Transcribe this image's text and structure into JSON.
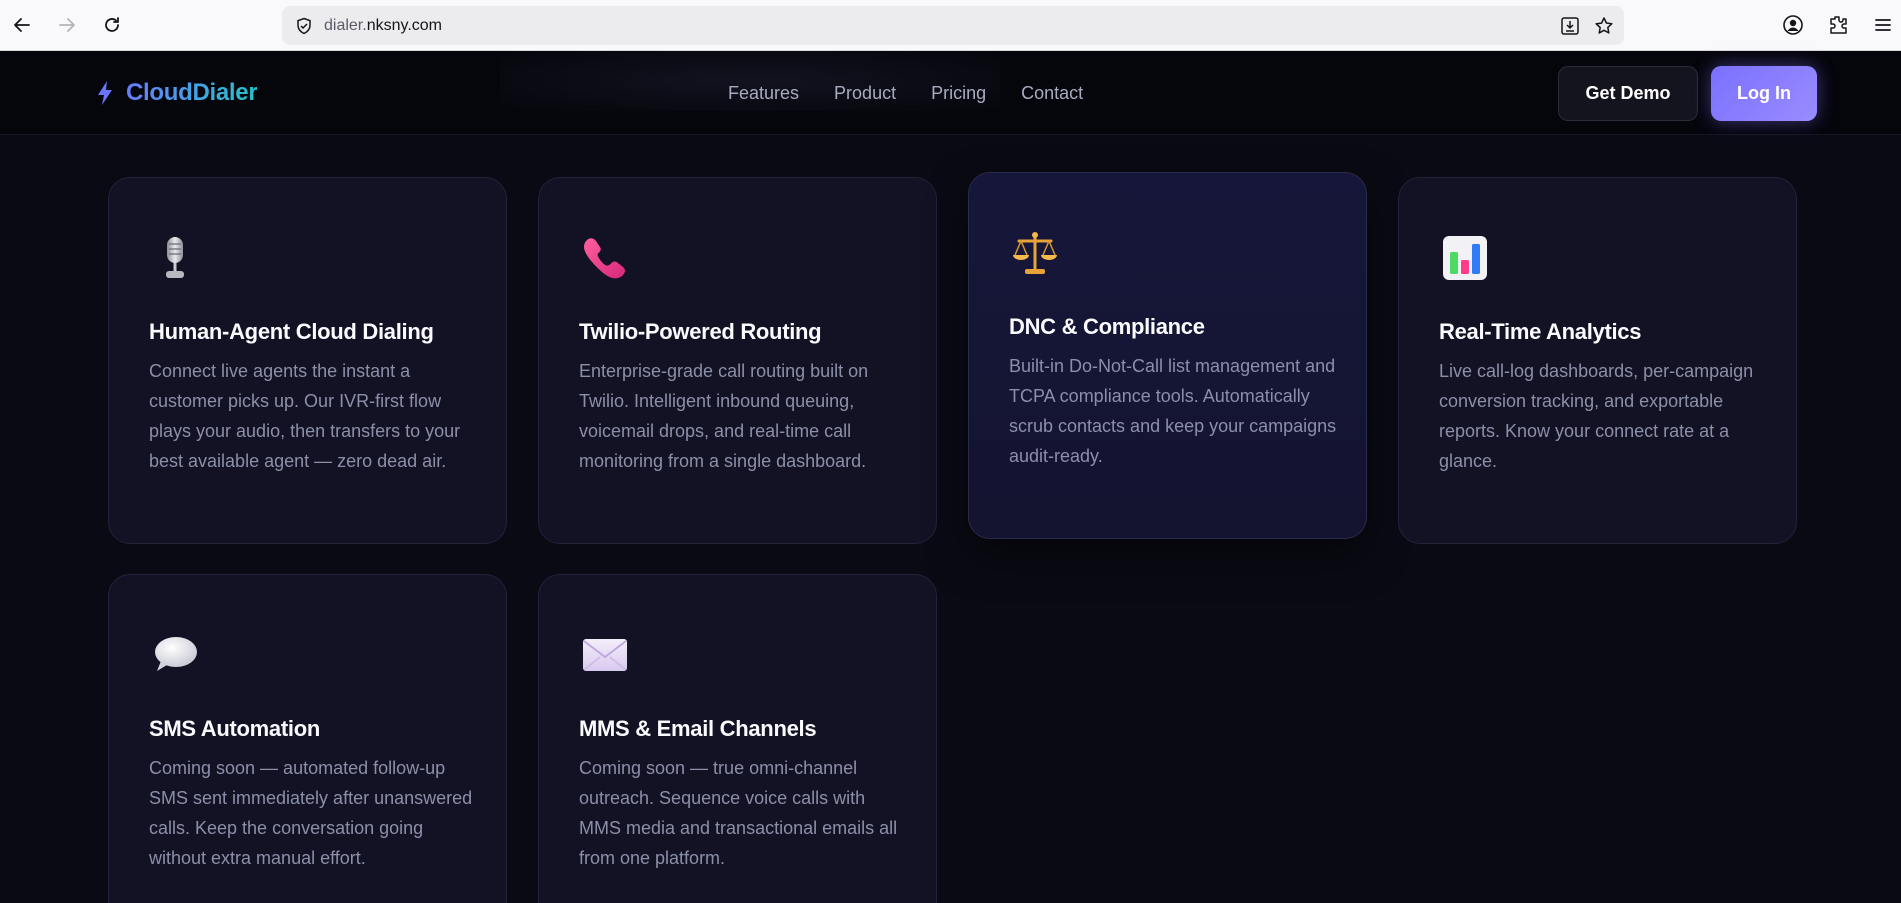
{
  "browser": {
    "url_prefix": "dialer.",
    "url_domain": "nksny.com"
  },
  "header": {
    "brand": "CloudDialer",
    "nav": [
      "Features",
      "Product",
      "Pricing",
      "Contact"
    ],
    "demo_label": "Get Demo",
    "login_label": "Log In",
    "accent_color": "#7a70ff"
  },
  "features": [
    {
      "icon": "microphone-icon",
      "title": "Human-Agent Cloud Dialing",
      "description": "Connect live agents the instant a customer picks up. Our IVR-first flow plays your audio, then transfers to your best available agent — zero dead air."
    },
    {
      "icon": "phone-icon",
      "title": "Twilio-Powered Routing",
      "description": "Enterprise-grade call routing built on Twilio. Intelligent inbound queuing, voicemail drops, and real-time call monitoring from a single dashboard."
    },
    {
      "icon": "scales-icon",
      "title": "DNC & Compliance",
      "description": "Built-in Do-Not-Call list management and TCPA compliance tools. Automatically scrub contacts and keep your campaigns audit-ready."
    },
    {
      "icon": "bar-chart-icon",
      "title": "Real-Time Analytics",
      "description": "Live call-log dashboards, per-campaign conversion tracking, and exportable reports. Know your connect rate at a glance."
    },
    {
      "icon": "speech-bubble-icon",
      "title": "SMS Automation",
      "description": "Coming soon — automated follow-up SMS sent immediately after unanswered calls. Keep the conversation going without extra manual effort."
    },
    {
      "icon": "envelope-icon",
      "title": "MMS & Email Channels",
      "description": "Coming soon — true omni-channel outreach. Sequence voice calls with MMS media and transactional emails all from one platform."
    }
  ]
}
